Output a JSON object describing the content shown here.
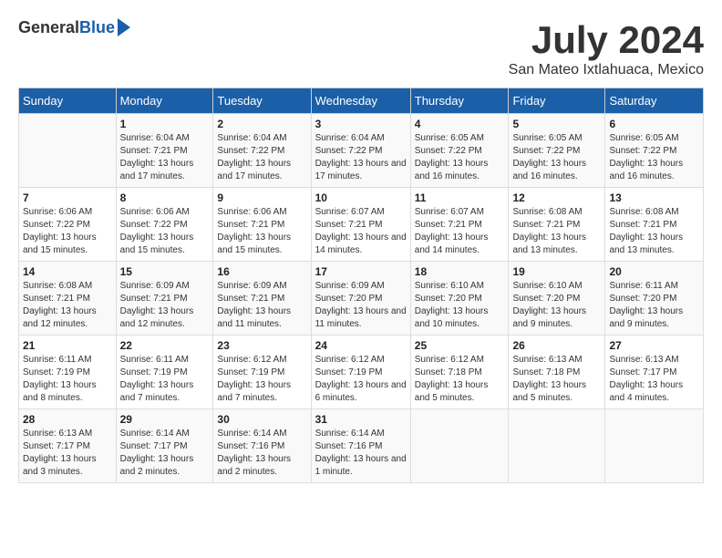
{
  "header": {
    "logo_general": "General",
    "logo_blue": "Blue",
    "month_title": "July 2024",
    "location": "San Mateo Ixtlahuaca, Mexico"
  },
  "days_of_week": [
    "Sunday",
    "Monday",
    "Tuesday",
    "Wednesday",
    "Thursday",
    "Friday",
    "Saturday"
  ],
  "weeks": [
    [
      {
        "day": "",
        "sunrise": "",
        "sunset": "",
        "daylight": ""
      },
      {
        "day": "1",
        "sunrise": "Sunrise: 6:04 AM",
        "sunset": "Sunset: 7:21 PM",
        "daylight": "Daylight: 13 hours and 17 minutes."
      },
      {
        "day": "2",
        "sunrise": "Sunrise: 6:04 AM",
        "sunset": "Sunset: 7:22 PM",
        "daylight": "Daylight: 13 hours and 17 minutes."
      },
      {
        "day": "3",
        "sunrise": "Sunrise: 6:04 AM",
        "sunset": "Sunset: 7:22 PM",
        "daylight": "Daylight: 13 hours and 17 minutes."
      },
      {
        "day": "4",
        "sunrise": "Sunrise: 6:05 AM",
        "sunset": "Sunset: 7:22 PM",
        "daylight": "Daylight: 13 hours and 16 minutes."
      },
      {
        "day": "5",
        "sunrise": "Sunrise: 6:05 AM",
        "sunset": "Sunset: 7:22 PM",
        "daylight": "Daylight: 13 hours and 16 minutes."
      },
      {
        "day": "6",
        "sunrise": "Sunrise: 6:05 AM",
        "sunset": "Sunset: 7:22 PM",
        "daylight": "Daylight: 13 hours and 16 minutes."
      }
    ],
    [
      {
        "day": "7",
        "sunrise": "Sunrise: 6:06 AM",
        "sunset": "Sunset: 7:22 PM",
        "daylight": "Daylight: 13 hours and 15 minutes."
      },
      {
        "day": "8",
        "sunrise": "Sunrise: 6:06 AM",
        "sunset": "Sunset: 7:22 PM",
        "daylight": "Daylight: 13 hours and 15 minutes."
      },
      {
        "day": "9",
        "sunrise": "Sunrise: 6:06 AM",
        "sunset": "Sunset: 7:21 PM",
        "daylight": "Daylight: 13 hours and 15 minutes."
      },
      {
        "day": "10",
        "sunrise": "Sunrise: 6:07 AM",
        "sunset": "Sunset: 7:21 PM",
        "daylight": "Daylight: 13 hours and 14 minutes."
      },
      {
        "day": "11",
        "sunrise": "Sunrise: 6:07 AM",
        "sunset": "Sunset: 7:21 PM",
        "daylight": "Daylight: 13 hours and 14 minutes."
      },
      {
        "day": "12",
        "sunrise": "Sunrise: 6:08 AM",
        "sunset": "Sunset: 7:21 PM",
        "daylight": "Daylight: 13 hours and 13 minutes."
      },
      {
        "day": "13",
        "sunrise": "Sunrise: 6:08 AM",
        "sunset": "Sunset: 7:21 PM",
        "daylight": "Daylight: 13 hours and 13 minutes."
      }
    ],
    [
      {
        "day": "14",
        "sunrise": "Sunrise: 6:08 AM",
        "sunset": "Sunset: 7:21 PM",
        "daylight": "Daylight: 13 hours and 12 minutes."
      },
      {
        "day": "15",
        "sunrise": "Sunrise: 6:09 AM",
        "sunset": "Sunset: 7:21 PM",
        "daylight": "Daylight: 13 hours and 12 minutes."
      },
      {
        "day": "16",
        "sunrise": "Sunrise: 6:09 AM",
        "sunset": "Sunset: 7:21 PM",
        "daylight": "Daylight: 13 hours and 11 minutes."
      },
      {
        "day": "17",
        "sunrise": "Sunrise: 6:09 AM",
        "sunset": "Sunset: 7:20 PM",
        "daylight": "Daylight: 13 hours and 11 minutes."
      },
      {
        "day": "18",
        "sunrise": "Sunrise: 6:10 AM",
        "sunset": "Sunset: 7:20 PM",
        "daylight": "Daylight: 13 hours and 10 minutes."
      },
      {
        "day": "19",
        "sunrise": "Sunrise: 6:10 AM",
        "sunset": "Sunset: 7:20 PM",
        "daylight": "Daylight: 13 hours and 9 minutes."
      },
      {
        "day": "20",
        "sunrise": "Sunrise: 6:11 AM",
        "sunset": "Sunset: 7:20 PM",
        "daylight": "Daylight: 13 hours and 9 minutes."
      }
    ],
    [
      {
        "day": "21",
        "sunrise": "Sunrise: 6:11 AM",
        "sunset": "Sunset: 7:19 PM",
        "daylight": "Daylight: 13 hours and 8 minutes."
      },
      {
        "day": "22",
        "sunrise": "Sunrise: 6:11 AM",
        "sunset": "Sunset: 7:19 PM",
        "daylight": "Daylight: 13 hours and 7 minutes."
      },
      {
        "day": "23",
        "sunrise": "Sunrise: 6:12 AM",
        "sunset": "Sunset: 7:19 PM",
        "daylight": "Daylight: 13 hours and 7 minutes."
      },
      {
        "day": "24",
        "sunrise": "Sunrise: 6:12 AM",
        "sunset": "Sunset: 7:19 PM",
        "daylight": "Daylight: 13 hours and 6 minutes."
      },
      {
        "day": "25",
        "sunrise": "Sunrise: 6:12 AM",
        "sunset": "Sunset: 7:18 PM",
        "daylight": "Daylight: 13 hours and 5 minutes."
      },
      {
        "day": "26",
        "sunrise": "Sunrise: 6:13 AM",
        "sunset": "Sunset: 7:18 PM",
        "daylight": "Daylight: 13 hours and 5 minutes."
      },
      {
        "day": "27",
        "sunrise": "Sunrise: 6:13 AM",
        "sunset": "Sunset: 7:17 PM",
        "daylight": "Daylight: 13 hours and 4 minutes."
      }
    ],
    [
      {
        "day": "28",
        "sunrise": "Sunrise: 6:13 AM",
        "sunset": "Sunset: 7:17 PM",
        "daylight": "Daylight: 13 hours and 3 minutes."
      },
      {
        "day": "29",
        "sunrise": "Sunrise: 6:14 AM",
        "sunset": "Sunset: 7:17 PM",
        "daylight": "Daylight: 13 hours and 2 minutes."
      },
      {
        "day": "30",
        "sunrise": "Sunrise: 6:14 AM",
        "sunset": "Sunset: 7:16 PM",
        "daylight": "Daylight: 13 hours and 2 minutes."
      },
      {
        "day": "31",
        "sunrise": "Sunrise: 6:14 AM",
        "sunset": "Sunset: 7:16 PM",
        "daylight": "Daylight: 13 hours and 1 minute."
      },
      {
        "day": "",
        "sunrise": "",
        "sunset": "",
        "daylight": ""
      },
      {
        "day": "",
        "sunrise": "",
        "sunset": "",
        "daylight": ""
      },
      {
        "day": "",
        "sunrise": "",
        "sunset": "",
        "daylight": ""
      }
    ]
  ]
}
